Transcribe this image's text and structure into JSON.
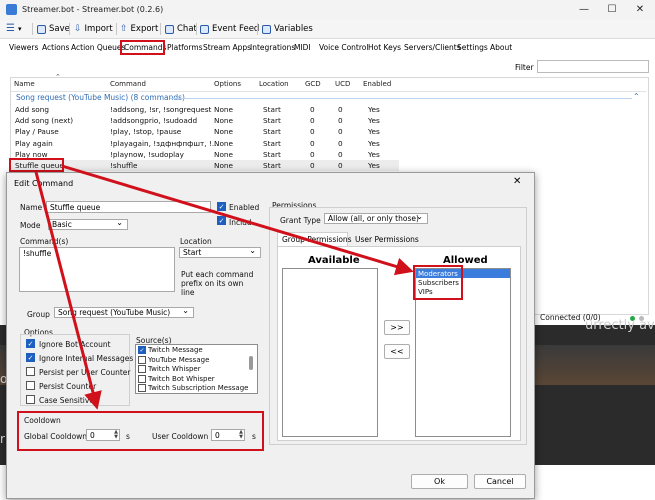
{
  "window": {
    "title": "Streamer.bot - Streamer.bot (0.2.6)"
  },
  "toolbar": {
    "save": "Save",
    "import": "Import",
    "export": "Export",
    "chat": "Chat",
    "event_feed": "Event Feed",
    "variables": "Variables"
  },
  "tabs": [
    "Viewers",
    "Actions",
    "Action Queues",
    "Commands",
    "Platforms",
    "Stream Apps",
    "Integrations",
    "MIDI",
    "Voice Control",
    "Hot Keys",
    "Servers/Clients",
    "Settings",
    "About"
  ],
  "filter_label": "Filter",
  "columns": [
    "Name",
    "Command",
    "Options",
    "Location",
    "GCD",
    "UCD",
    "Enabled"
  ],
  "group_label": "Song request (YouTube Music) (8 commands)",
  "rows": [
    {
      "name": "Add song",
      "command": "!addsong, !sr, !songrequest",
      "options": "None",
      "location": "Start",
      "gcd": "0",
      "ucd": "0",
      "enabled": "Yes"
    },
    {
      "name": "Add song (next)",
      "command": "!addsongprio, !sudoadd",
      "options": "None",
      "location": "Start",
      "gcd": "0",
      "ucd": "0",
      "enabled": "Yes"
    },
    {
      "name": "Play / Pause",
      "command": "!play, !stop, !pause",
      "options": "None",
      "location": "Start",
      "gcd": "0",
      "ucd": "0",
      "enabled": "Yes"
    },
    {
      "name": "Play again",
      "command": "!playagain, !здфнфпфшт, !...",
      "options": "None",
      "location": "Start",
      "gcd": "0",
      "ucd": "0",
      "enabled": "Yes"
    },
    {
      "name": "Play now",
      "command": "!playnow, !sudoplay",
      "options": "None",
      "location": "Start",
      "gcd": "0",
      "ucd": "0",
      "enabled": "Yes"
    },
    {
      "name": "Stuffle queue",
      "command": "!shuffle",
      "options": "None",
      "location": "Start",
      "gcd": "0",
      "ucd": "0",
      "enabled": "Yes"
    }
  ],
  "status": "Connected (0/0)",
  "background": {
    "text1": "urrectly availa",
    "text2": "op",
    "text3": "r"
  },
  "dialog": {
    "title": "Edit Command",
    "name_label": "Name",
    "name_value": "Stuffle queue",
    "enabled_label": "Enabled",
    "include_label": "Includ",
    "mode_label": "Mode",
    "mode_value": "Basic",
    "commands_label": "Command(s)",
    "commands_value": "!shuffle",
    "location_label": "Location",
    "location_value": "Start",
    "location_hint": "Put each command prefix on its own line",
    "group_label": "Group",
    "group_value": "Song request (YouTube Music)",
    "options_label": "Options",
    "options": [
      {
        "label": "Ignore Bot Account",
        "checked": true
      },
      {
        "label": "Ignore Internal Messages",
        "checked": true
      },
      {
        "label": "Persist per User Counter",
        "checked": false
      },
      {
        "label": "Persist Counter",
        "checked": false
      },
      {
        "label": "Case Sensitive",
        "checked": false
      }
    ],
    "sources_label": "Source(s)",
    "sources": [
      {
        "label": "Twitch Message",
        "checked": true
      },
      {
        "label": "YouTube Message",
        "checked": false
      },
      {
        "label": "Twitch Whisper",
        "checked": false
      },
      {
        "label": "Twitch Bot Whisper",
        "checked": false
      },
      {
        "label": "Twitch Subscription Message",
        "checked": false
      }
    ],
    "cooldown_label": "Cooldown",
    "global_cooldown_label": "Global Cooldown",
    "global_cooldown_value": "0",
    "user_cooldown_label": "User Cooldown",
    "user_cooldown_value": "0",
    "seconds_unit": "s",
    "permissions_label": "Permissions",
    "grant_type_label": "Grant Type",
    "grant_type_value": "Allow (all, or only those)",
    "tab_group": "Group Permissions",
    "tab_user": "User Permissions",
    "available_label": "Available",
    "allowed_label": "Allowed",
    "allowed_items": [
      "Moderators",
      "Subscribers",
      "VIPs"
    ],
    "add_btn": ">>",
    "remove_btn": "<<",
    "ok": "Ok",
    "cancel": "Cancel"
  },
  "colors": {
    "accent": "#1f5fbf",
    "highlight": "#d0101a",
    "selected": "#3b7ddd"
  }
}
